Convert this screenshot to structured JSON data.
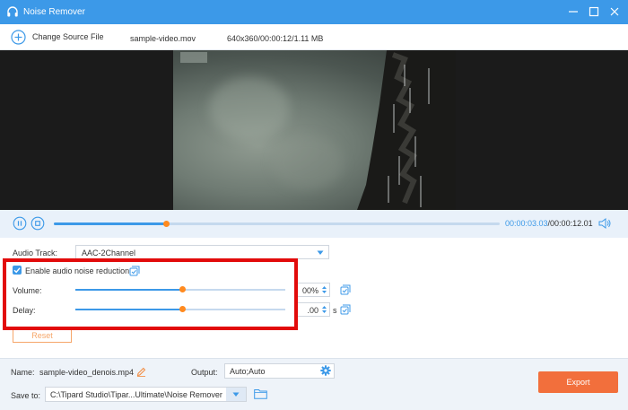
{
  "window": {
    "title": "Noise Remover"
  },
  "toolbar": {
    "change_source_label": "Change Source File",
    "file_name": "sample-video.mov",
    "file_info": "640x360/00:00:12/1.11 MB"
  },
  "player": {
    "current_time": "00:00:03.03",
    "total_time": "/00:00:12.01",
    "progress_percent": 25.2
  },
  "settings": {
    "audio_track_label": "Audio Track:",
    "audio_track_value": "AAC-2Channel",
    "enable_noise_label": "Enable audio noise reduction",
    "enable_noise_checked": true,
    "volume_label": "Volume:",
    "volume_value": "00%",
    "volume_slider_percent": 51,
    "delay_label": "Delay:",
    "delay_value": ".00",
    "delay_unit": "s",
    "delay_slider_percent": 51,
    "reset_label": "Reset"
  },
  "footer": {
    "name_label": "Name:",
    "name_value": "sample-video_denois.mp4",
    "output_label": "Output:",
    "output_value": "Auto;Auto",
    "save_to_label": "Save to:",
    "save_to_value": "C:\\Tipard Studio\\Tipar...Ultimate\\Noise Remover",
    "export_label": "Export"
  },
  "colors": {
    "accent": "#3c99e8",
    "thumb": "#ff8a1f",
    "export": "#f26f3c",
    "highlight": "#e20b0b"
  }
}
